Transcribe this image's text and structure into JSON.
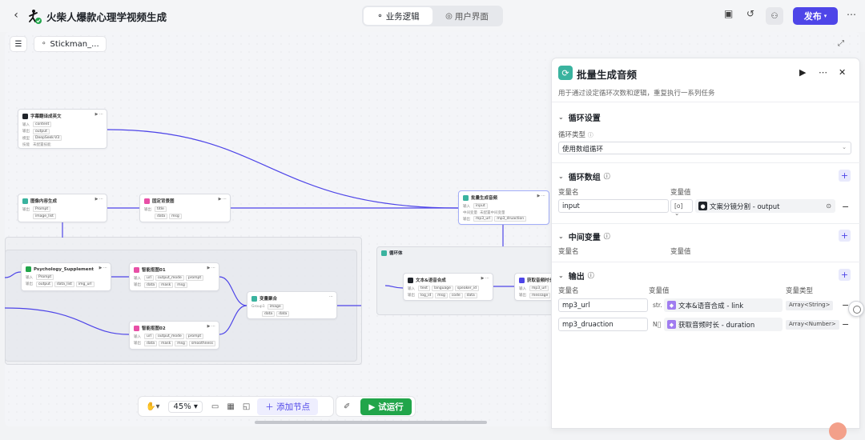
{
  "header": {
    "title": "火柴人爆款心理学视频生成",
    "tabs": [
      {
        "label": "业务逻辑",
        "active": true,
        "icon": "flow-icon"
      },
      {
        "label": "用户界面",
        "active": false,
        "icon": "palette-icon"
      }
    ],
    "publish_label": "发布"
  },
  "canvas": {
    "workflow_name": "Stickman_...",
    "zoom": "45%",
    "add_node_label": "添加节点",
    "run_label": "试运行",
    "nodes": [
      {
        "id": "n1",
        "title": "字幕翻译成英文",
        "icon_color": "#1f2329",
        "rows": [
          [
            "输入",
            "content"
          ],
          [
            "输出",
            "output"
          ],
          [
            "模型",
            "DeepSeek-V3"
          ],
          [
            "技能",
            "未配置技能"
          ]
        ]
      },
      {
        "id": "n2",
        "title": "图像内容生成",
        "icon_color": "#3ab39f",
        "rows": [
          [
            "输出",
            "Prompt"
          ],
          [
            "",
            "image_list"
          ]
        ]
      },
      {
        "id": "n3",
        "title": "固定背景图",
        "icon_color": "#e84fa6",
        "rows": [
          [
            "输出",
            "title"
          ],
          [
            "",
            "data",
            "msg"
          ]
        ]
      },
      {
        "id": "n4",
        "title": "批量生成音频",
        "icon_color": "#3ab39f",
        "rows": [
          [
            "输入",
            "input"
          ],
          [
            "中间变量",
            "未配置中间变量"
          ],
          [
            "输出",
            "mp3_url",
            "mp3_druaction"
          ]
        ]
      },
      {
        "id": "n5",
        "title": "Psychology_Supplement",
        "icon_color": "#21a54a",
        "rows": [
          [
            "输入",
            "Prompt"
          ],
          [
            "输出",
            "output",
            "data_list",
            "img_url"
          ]
        ]
      },
      {
        "id": "n6",
        "title": "智能抠图01",
        "icon_color": "#e84fa6",
        "rows": [
          [
            "输入",
            "url",
            "output_mode",
            "prompt"
          ],
          [
            "输出",
            "data",
            "mask",
            "msg"
          ]
        ]
      },
      {
        "id": "n7",
        "title": "智能抠图02",
        "icon_color": "#e84fa6",
        "rows": [
          [
            "输入",
            "url",
            "output_mode",
            "prompt"
          ],
          [
            "输出",
            "data",
            "mask",
            "msg",
            "smoothness"
          ]
        ]
      },
      {
        "id": "n8",
        "title": "变量聚合",
        "icon_color": "#3ab39f",
        "rows": [
          [
            "Group1",
            "image"
          ],
          [
            "",
            "data",
            "data"
          ]
        ]
      },
      {
        "id": "n9",
        "title": "文本&语音合成",
        "icon_color": "#1f2329",
        "rows": [
          [
            "输入",
            "text",
            "language",
            "speaker_id"
          ],
          [
            "输出",
            "log_id",
            "msg",
            "code",
            "data"
          ]
        ]
      },
      {
        "id": "n10",
        "title": "获取音频时长",
        "icon_color": "#4e45e8",
        "rows": [
          [
            "输入",
            "mp3_url"
          ],
          [
            "输出",
            "message"
          ]
        ]
      },
      {
        "id": "n11",
        "title": "循环体",
        "icon_color": "#3ab39f",
        "rows": []
      }
    ]
  },
  "panel": {
    "title": "批量生成音频",
    "description": "用于通过设定循环次数和逻辑，重复执行一系列任务",
    "loop_settings": {
      "heading": "循环设置",
      "type_label": "循环类型",
      "type_value": "使用数组循环"
    },
    "loop_array": {
      "heading": "循环数组",
      "col_name": "变量名",
      "col_value": "变量值",
      "row": {
        "name": "input",
        "type_prefix": "[o]",
        "source": "文案分镜分割 - output"
      }
    },
    "intermediate": {
      "heading": "中间变量",
      "col_name": "变量名",
      "col_value": "变量值"
    },
    "output": {
      "heading": "输出",
      "col_name": "变量名",
      "col_value": "变量值",
      "col_type": "变量类型",
      "rows": [
        {
          "name": "mp3_url",
          "prefix": "str.",
          "source": "文本&语音合成 - link",
          "type": "Array<String>",
          "icon_color": "#a07cf0"
        },
        {
          "name": "mp3_druaction",
          "prefix": "N⃞",
          "source": "获取音频时长 - duration",
          "type": "Array<Number>",
          "icon_color": "#a07cf0"
        }
      ]
    }
  },
  "colors": {
    "accent": "#4e45e8",
    "run": "#21a54a",
    "loop": "#3ab39f"
  }
}
